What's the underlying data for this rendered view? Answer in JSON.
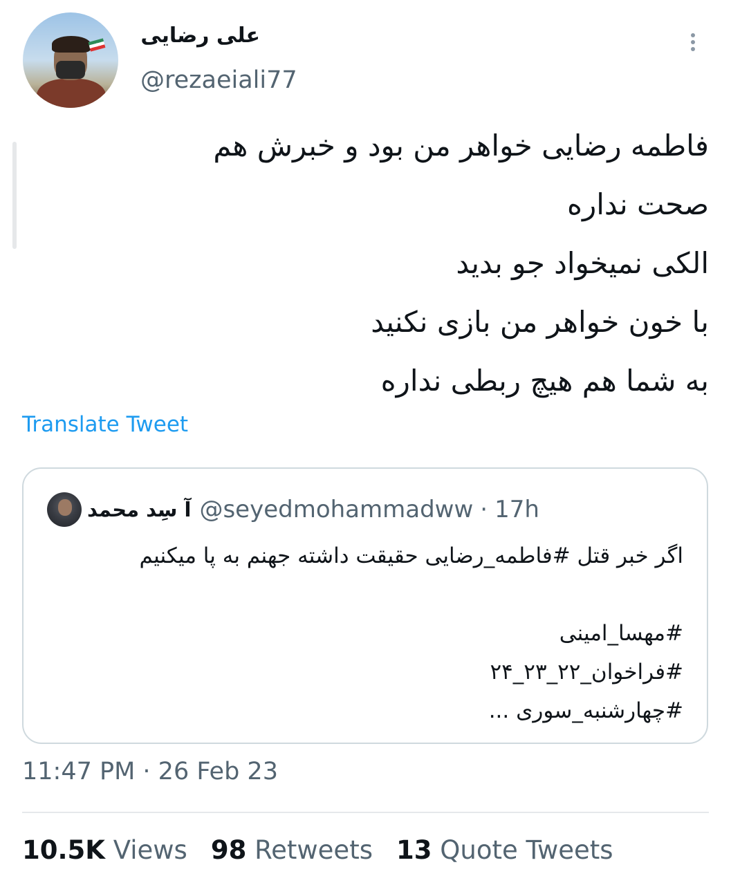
{
  "author": {
    "display_name": "علی رضایی",
    "handle": "@rezaeiali77"
  },
  "tweet": {
    "lines": [
      "فاطمه رضایی خواهر من بود و خبرش هم",
      "صحت نداره",
      "الکی نمیخواد جو بدید",
      "با خون خواهر من بازی نکنید",
      "به شما هم هیچ ربطی نداره"
    ],
    "translate_label": "Translate Tweet"
  },
  "quoted_tweet": {
    "display_name": "آ سِد محمد",
    "handle": "@seyedmohammadww",
    "separator": "·",
    "time": "17h",
    "lines": [
      "اگر خبر قتل #فاطمه_رضایی حقیقت داشته جهنم به پا میکنیم",
      "",
      "#مهسا_امینی",
      "#فراخوان_۲۲_۲۳_۲۴",
      "#چهارشنبه_سوری ..."
    ]
  },
  "meta": {
    "timestamp": "11:47 PM · 26 Feb 23"
  },
  "stats": {
    "views_count": "10.5K",
    "views_label": "Views",
    "retweets_count": "98",
    "retweets_label": "Retweets",
    "quotes_count": "13",
    "quotes_label": "Quote Tweets"
  },
  "icons": {
    "more": "more-vertical-icon",
    "avatar": "profile-avatar"
  },
  "colors": {
    "link": "#1d9bf0",
    "secondary_text": "#536471",
    "border": "#cfd9de"
  }
}
